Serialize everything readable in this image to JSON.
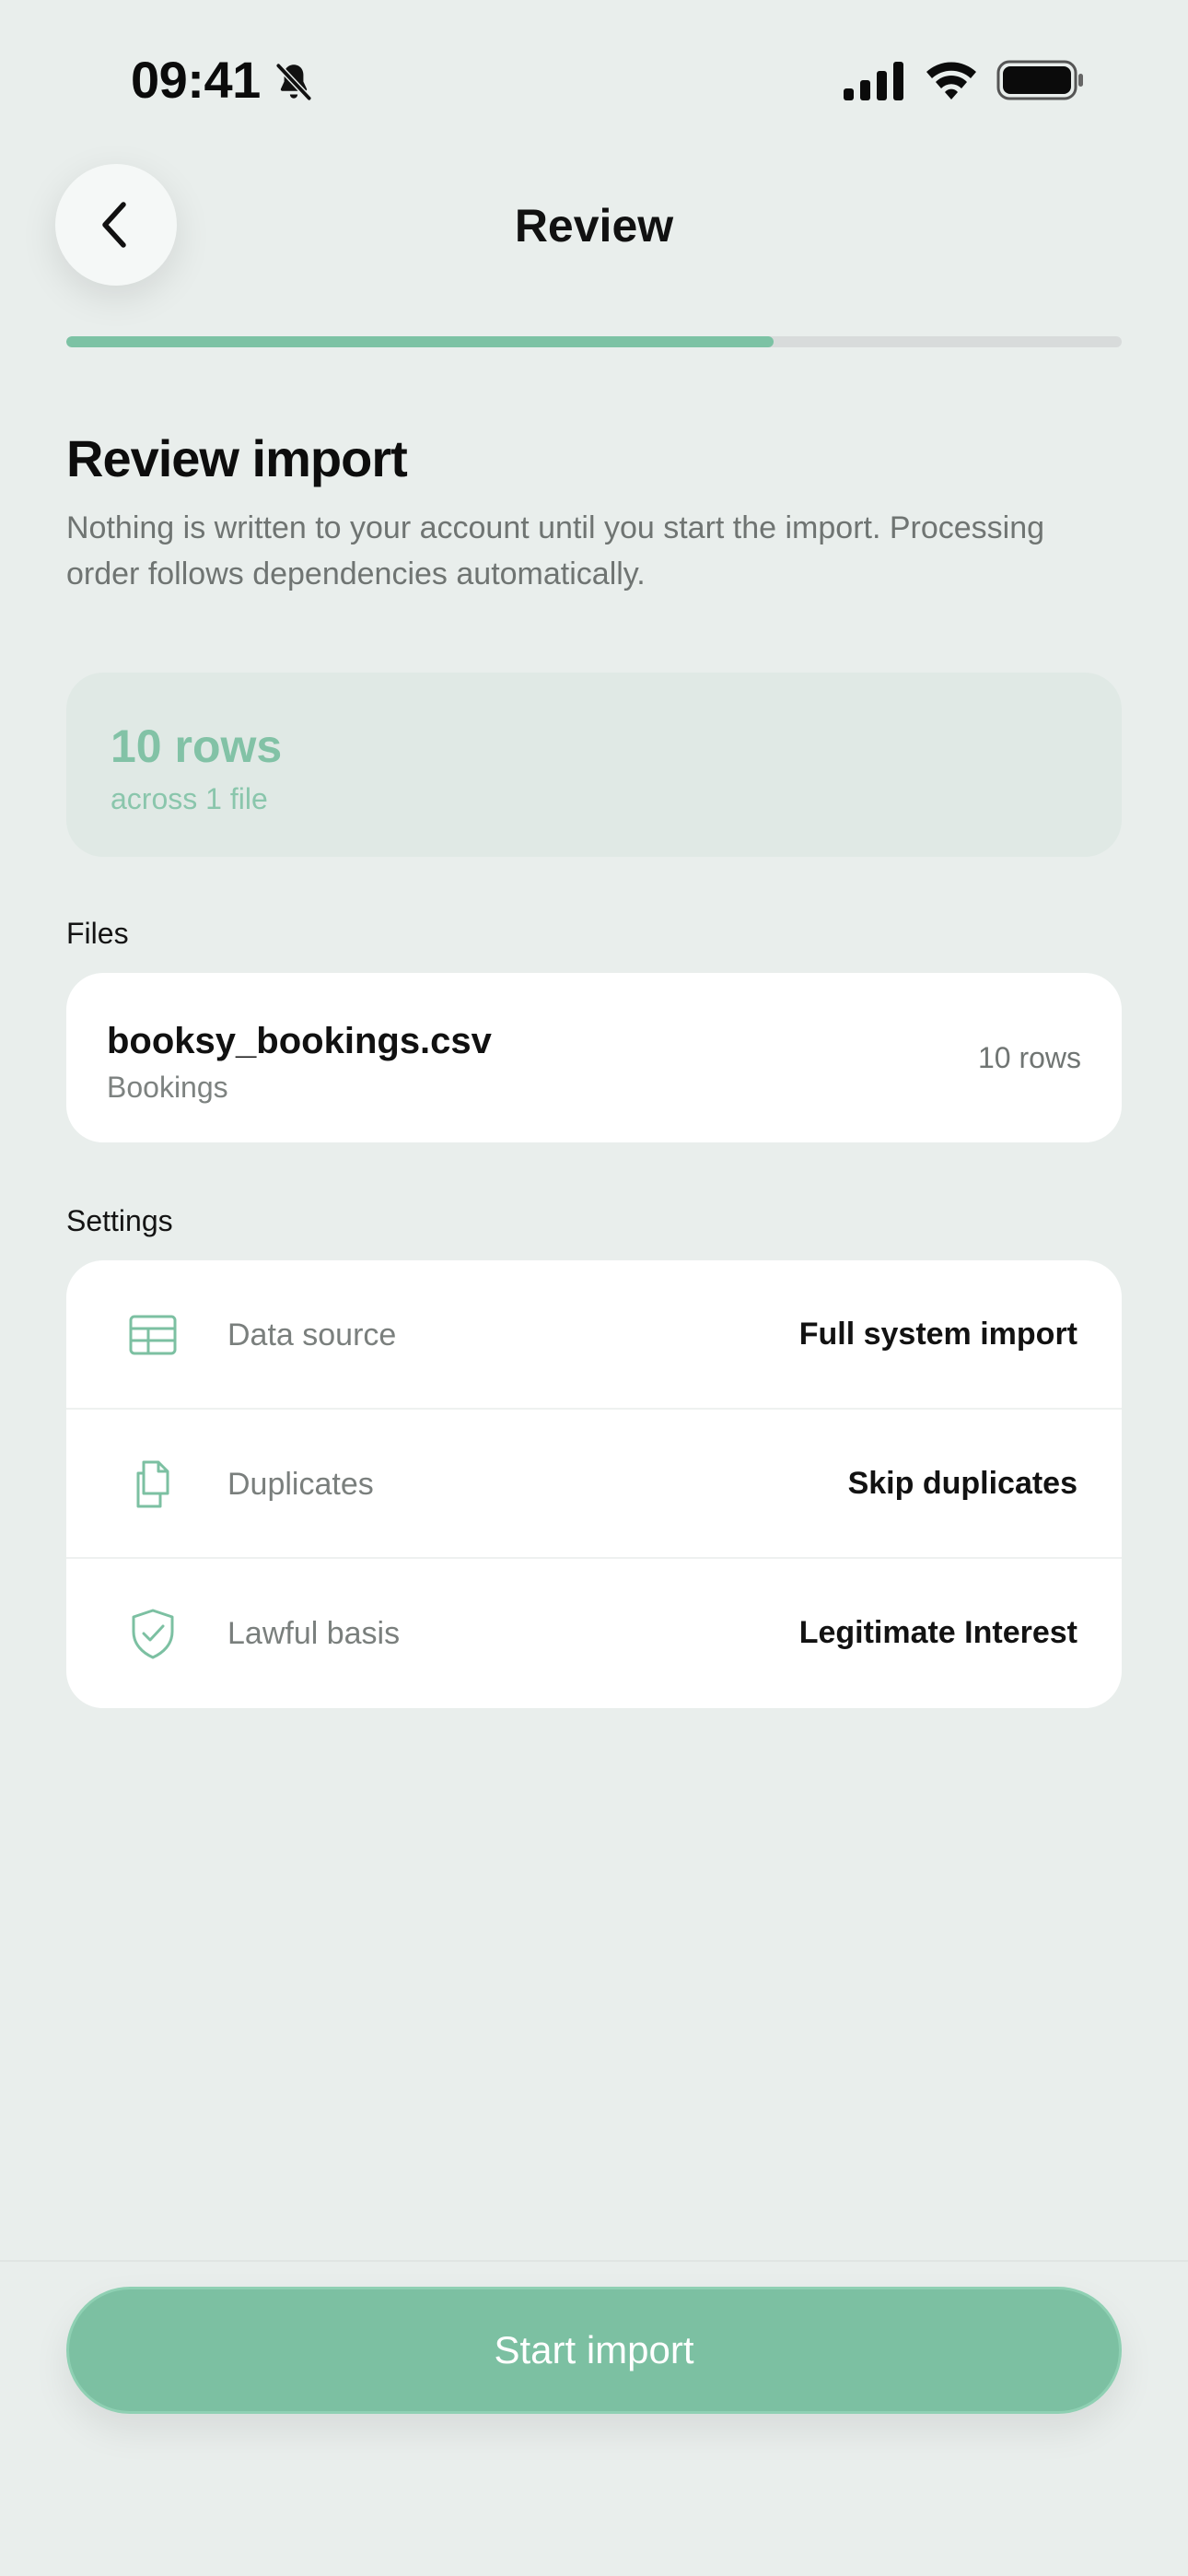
{
  "status_bar": {
    "time": "09:41",
    "icons": [
      "bell-slash-icon",
      "cellular-signal-icon",
      "wifi-icon",
      "battery-icon"
    ]
  },
  "header": {
    "title": "Review",
    "back_icon": "chevron-left-icon"
  },
  "progress": {
    "value": 0.67
  },
  "main": {
    "heading": "Review import",
    "subtitle": "Nothing is written to your account until you start the import. Processing order follows dependencies automatically."
  },
  "summary": {
    "rows_text": "10 rows",
    "files_text": "across 1 file"
  },
  "files_section": {
    "label": "Files",
    "items": [
      {
        "name": "booksy_bookings.csv",
        "type": "Bookings",
        "rows": "10 rows"
      }
    ]
  },
  "settings_section": {
    "label": "Settings",
    "items": [
      {
        "icon": "table-icon",
        "label": "Data source",
        "value": "Full system import"
      },
      {
        "icon": "documents-icon",
        "label": "Duplicates",
        "value": "Skip duplicates"
      },
      {
        "icon": "shield-check-icon",
        "label": "Lawful basis",
        "value": "Legitimate Interest"
      }
    ]
  },
  "footer": {
    "start_label": "Start import"
  },
  "colors": {
    "background": "#e9eeec",
    "accent": "#7cc0a2",
    "summary_card": "#e0e9e5",
    "card": "#ffffff"
  }
}
